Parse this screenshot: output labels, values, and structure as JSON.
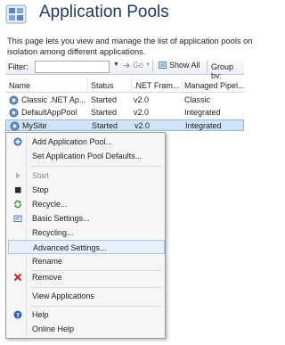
{
  "header": {
    "title": "Application Pools",
    "description_line1": "This page lets you view and manage the list of application pools on",
    "description_line2": "isolation among different applications."
  },
  "toolbar": {
    "filter_label": "Filter:",
    "filter_value": "",
    "go_label": "Go",
    "show_all_label": "Show All",
    "group_by_label": "Group by:"
  },
  "grid": {
    "columns": [
      "Name",
      "Status",
      ".NET Fram...",
      "Managed Pipel..."
    ],
    "rows": [
      {
        "name": "Classic .NET Ap...",
        "status": "Started",
        "net": "v2.0",
        "pipeline": "Classic"
      },
      {
        "name": "DefaultAppPool",
        "status": "Started",
        "net": "v2.0",
        "pipeline": "Integrated"
      },
      {
        "name": "MySite",
        "status": "Started",
        "net": "v2.0",
        "pipeline": "Integrated"
      }
    ]
  },
  "context_menu": {
    "items": [
      {
        "label": "Add Application Pool...",
        "icon": "add-pool-icon",
        "disabled": false
      },
      {
        "label": "Set Application Pool Defaults...",
        "icon": "",
        "disabled": false
      },
      {
        "label": "Start",
        "icon": "play-icon",
        "disabled": true
      },
      {
        "label": "Stop",
        "icon": "stop-icon",
        "disabled": false
      },
      {
        "label": "Recycle...",
        "icon": "recycle-icon",
        "disabled": false
      },
      {
        "label": "Basic Settings...",
        "icon": "settings-icon",
        "disabled": false
      },
      {
        "label": "Recycling...",
        "icon": "",
        "disabled": false
      },
      {
        "label": "Advanced Settings...",
        "icon": "",
        "disabled": false,
        "highlighted": true
      },
      {
        "label": "Rename",
        "icon": "",
        "disabled": false
      },
      {
        "label": "Remove",
        "icon": "remove-icon",
        "disabled": false
      },
      {
        "label": "View Applications",
        "icon": "",
        "disabled": false
      },
      {
        "label": "Help",
        "icon": "help-icon",
        "disabled": false
      },
      {
        "label": "Online Help",
        "icon": "",
        "disabled": false
      }
    ]
  },
  "colors": {
    "title": "#1e3a5f",
    "selection": "#cfe3f7",
    "menu_background": "#f5f6f7",
    "remove_icon": "#d0201a",
    "help_icon": "#2a63b8"
  }
}
